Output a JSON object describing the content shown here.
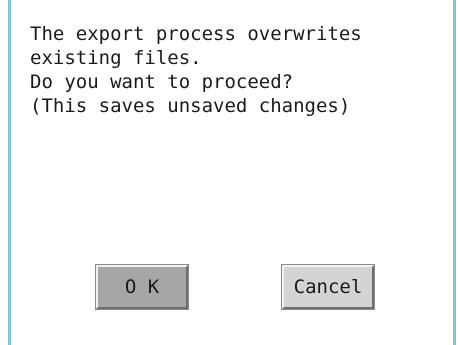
{
  "dialog": {
    "message_lines": [
      "The export process overwrites",
      "existing files.",
      "Do you want to proceed?",
      "(This saves unsaved changes)"
    ],
    "ok_label": "O K",
    "cancel_label": "Cancel"
  },
  "colors": {
    "frame_accent": "#7ec6d4",
    "ok_button_bg": "#a6a6a6",
    "cancel_button_bg": "#d4d4d4",
    "text": "#1a1a1a"
  }
}
